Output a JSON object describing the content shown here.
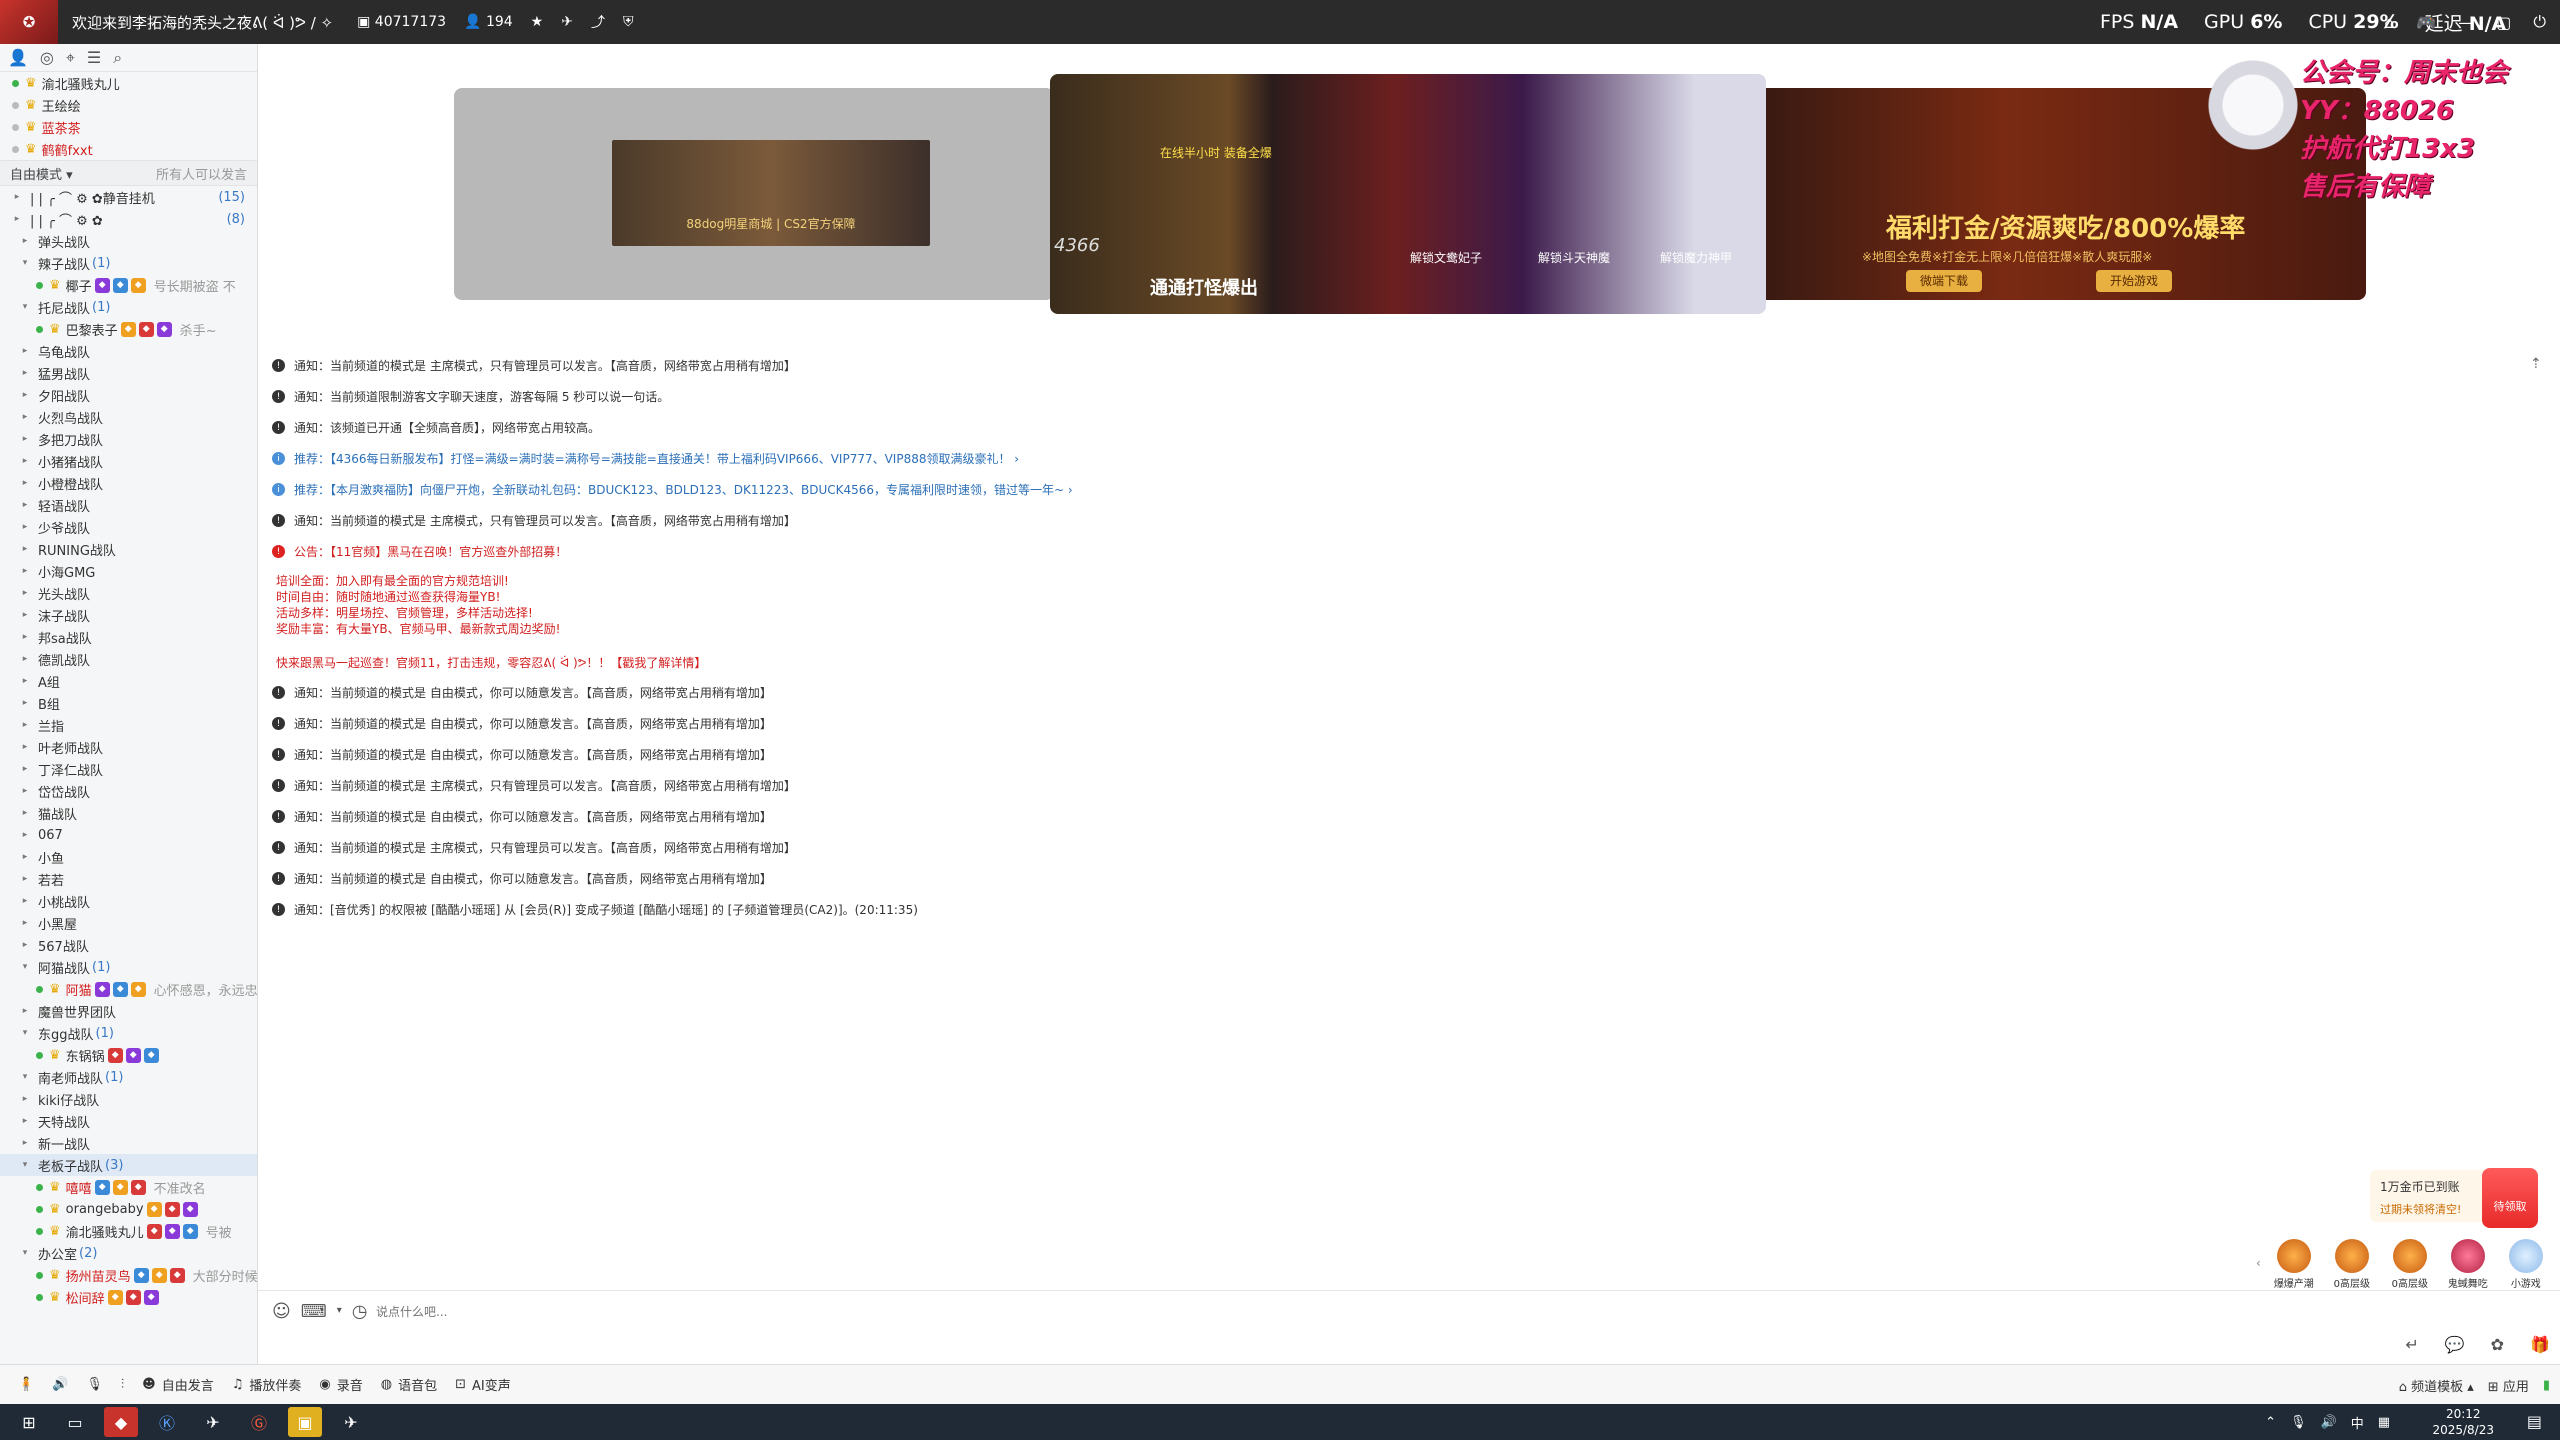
{
  "topbar": {
    "title": "欢迎来到李拓海的秃头之夜ᕕ( ᐛ )ᕗ / ✧",
    "channel_id": "40717173",
    "online": "194",
    "fps_label": "FPS",
    "fps_value": "N/A",
    "gpu_label": "GPU",
    "gpu_value": "6%",
    "cpu_label": "CPU",
    "cpu_value": "29%",
    "latency_label": "延迟",
    "latency_value": "N/A"
  },
  "sidebar": {
    "top_users": [
      {
        "name": "渝北骚贱丸儿",
        "online": true
      },
      {
        "name": "王绘绘",
        "online": false
      },
      {
        "name": "蓝茶茶",
        "online": false,
        "red": true
      },
      {
        "name": "鹤鹤fxxt",
        "online": false,
        "red": true
      }
    ],
    "mode": "自由模式 ▾",
    "mode_note": "所有人可以发言",
    "special": [
      {
        "name": "静音挂机",
        "count": "(15)"
      },
      {
        "name": "",
        "count": "(8)"
      }
    ],
    "channels": [
      {
        "name": "弹头战队"
      },
      {
        "name": "辣子战队",
        "count": "(1)"
      },
      {
        "name": "椰子",
        "sub": true,
        "note": "号长期被盗 不"
      },
      {
        "name": "托尼战队",
        "count": "(1)"
      },
      {
        "name": "巴黎表子",
        "sub": true,
        "note": "杀手~"
      },
      {
        "name": "乌龟战队"
      },
      {
        "name": "猛男战队"
      },
      {
        "name": "夕阳战队"
      },
      {
        "name": "火烈鸟战队"
      },
      {
        "name": "多把刀战队"
      },
      {
        "name": "小猪猪战队"
      },
      {
        "name": "小橙橙战队"
      },
      {
        "name": "轻语战队"
      },
      {
        "name": "少爷战队"
      },
      {
        "name": "RUNING战队"
      },
      {
        "name": "小海GMG"
      },
      {
        "name": "光头战队"
      },
      {
        "name": "沫子战队"
      },
      {
        "name": "邦sa战队"
      },
      {
        "name": "德凯战队"
      },
      {
        "name": "A组"
      },
      {
        "name": "B组"
      },
      {
        "name": "兰指"
      },
      {
        "name": "叶老师战队"
      },
      {
        "name": "丁泽仁战队"
      },
      {
        "name": "岱岱战队"
      },
      {
        "name": "猫战队"
      },
      {
        "name": "067"
      },
      {
        "name": "小鱼"
      },
      {
        "name": "若若"
      },
      {
        "name": "小桃战队"
      },
      {
        "name": "小黑屋"
      },
      {
        "name": "567战队"
      },
      {
        "name": "阿猫战队",
        "count": "(1)"
      },
      {
        "name": "阿猫",
        "sub": true,
        "red": true,
        "note": "心怀感恩，永远忠诚"
      },
      {
        "name": "魔兽世界团队"
      },
      {
        "name": "东gg战队",
        "count": "(1)"
      },
      {
        "name": "东锅锅",
        "sub": true
      },
      {
        "name": "南老师战队",
        "count": "(1)"
      },
      {
        "name": "kiki仔战队"
      },
      {
        "name": "天特战队"
      },
      {
        "name": "新一战队"
      },
      {
        "name": "老板子战队",
        "count": "(3)",
        "selected": true
      },
      {
        "name": "嘻嘻",
        "sub": true,
        "red": true,
        "note": "不准改名"
      },
      {
        "name": "orangebaby",
        "sub": true
      },
      {
        "name": "渝北骚贱丸儿",
        "sub": true,
        "note": "号被"
      },
      {
        "name": "办公室",
        "count": "(2)"
      },
      {
        "name": "扬州苗灵鸟",
        "sub": true,
        "red": true,
        "note": "大部分时候不在"
      },
      {
        "name": "松间辞",
        "sub": true,
        "red": true
      }
    ]
  },
  "banner": {
    "left_caption": "88dog明星商城 | CS2官方保障",
    "game_top": "在线半小时 装备全爆",
    "game_caption": "通通打怪爆出",
    "game_brand": "4366",
    "unlock": [
      "解锁文鸯妃子",
      "解锁斗天神魔",
      "解锁魔力神甲"
    ],
    "right_title": "福利打金/资源爽吃/800%爆率",
    "right_sub": "※地图全免费※打金无上限※几倍倍狂爆※散人爽玩服※",
    "right_btn1": "微端下载",
    "right_btn2": "开始游戏"
  },
  "ad": {
    "lines": [
      "公会号：周末也会",
      "YY：88026",
      "护航代打13x3",
      "售后有保障"
    ]
  },
  "messages": [
    {
      "type": "notice",
      "text": "通知：当前频道的模式是 主席模式，只有管理员可以发言。【高音质，网络带宽占用稍有增加】"
    },
    {
      "type": "notice",
      "text": "通知：当前频道限制游客文字聊天速度，游客每隔 5 秒可以说一句话。"
    },
    {
      "type": "notice",
      "text": "通知：该频道已开通【全频高音质】，网络带宽占用较高。"
    },
    {
      "type": "rec",
      "text": "推荐：【4366每日新服发布】打怪=满级=满时装=满称号=满技能=直接通关！带上福利码VIP666、VIP777、VIP888领取满级豪礼！ ›"
    },
    {
      "type": "rec",
      "text": "推荐：【本月激爽福防】向僵尸开炮，全新联动礼包码：BDUCK123、BDLD123、DK11223、BDUCK4566，专属福利限时速领，错过等一年~ ›"
    },
    {
      "type": "notice",
      "text": "通知：当前频道的模式是 主席模式，只有管理员可以发言。【高音质，网络带宽占用稍有增加】"
    },
    {
      "type": "ann",
      "text": "公告：【11官频】黑马在召唤！官方巡查外部招募！"
    }
  ],
  "recruit": {
    "lines": [
      "培训全面：加入即有最全面的官方规范培训!",
      "时间自由：随时随地通过巡查获得海量YB!",
      "活动多样：明星场控、官频管理，多样活动选择!",
      "奖励丰富：有大量YB、官频马甲、最新款式周边奖励!"
    ],
    "cta": "快来跟黑马一起巡查！官频11，打击违规，零容忍ᕕ( ᐛ )ᕗ！！【戳我了解详情】"
  },
  "messages2": [
    {
      "type": "notice",
      "text": "通知：当前频道的模式是 自由模式，你可以随意发言。【高音质，网络带宽占用稍有增加】"
    },
    {
      "type": "notice",
      "text": "通知：当前频道的模式是 自由模式，你可以随意发言。【高音质，网络带宽占用稍有增加】"
    },
    {
      "type": "notice",
      "text": "通知：当前频道的模式是 自由模式，你可以随意发言。【高音质，网络带宽占用稍有增加】"
    },
    {
      "type": "notice",
      "text": "通知：当前频道的模式是 主席模式，只有管理员可以发言。【高音质，网络带宽占用稍有增加】"
    },
    {
      "type": "notice",
      "text": "通知：当前频道的模式是 自由模式，你可以随意发言。【高音质，网络带宽占用稍有增加】"
    },
    {
      "type": "notice",
      "text": "通知：当前频道的模式是 主席模式，只有管理员可以发言。【高音质，网络带宽占用稍有增加】"
    },
    {
      "type": "notice",
      "text": "通知：当前频道的模式是 自由模式，你可以随意发言。【高音质，网络带宽占用稍有增加】"
    },
    {
      "type": "notice",
      "text": "通知：[音优秀] 的权限被 [酷酷小瑶瑶] 从 [会员(R)] 变成子频道 [酷酷小瑶瑶] 的 [子频道管理员(CA2)]。(20:11:35)"
    }
  ],
  "widgets": {
    "gold_title": "1万金币已到账",
    "gold_sub": "过期未领将清空!",
    "redpacket": "待领取",
    "gifts": [
      "爆爆产潮",
      "0高层级",
      "0高层级",
      "鬼蜮舞吃"
    ],
    "mini_game": "小游戏"
  },
  "input": {
    "placeholder": "说点什么吧..."
  },
  "bottombar": {
    "items": [
      "自由发言",
      "播放伴奏",
      "录音",
      "语音包",
      "AI变声"
    ],
    "right": [
      "频道模板 ▴",
      "应用"
    ]
  },
  "taskbar": {
    "time": "20:12",
    "date": "2025/8/23",
    "ime": "中"
  }
}
